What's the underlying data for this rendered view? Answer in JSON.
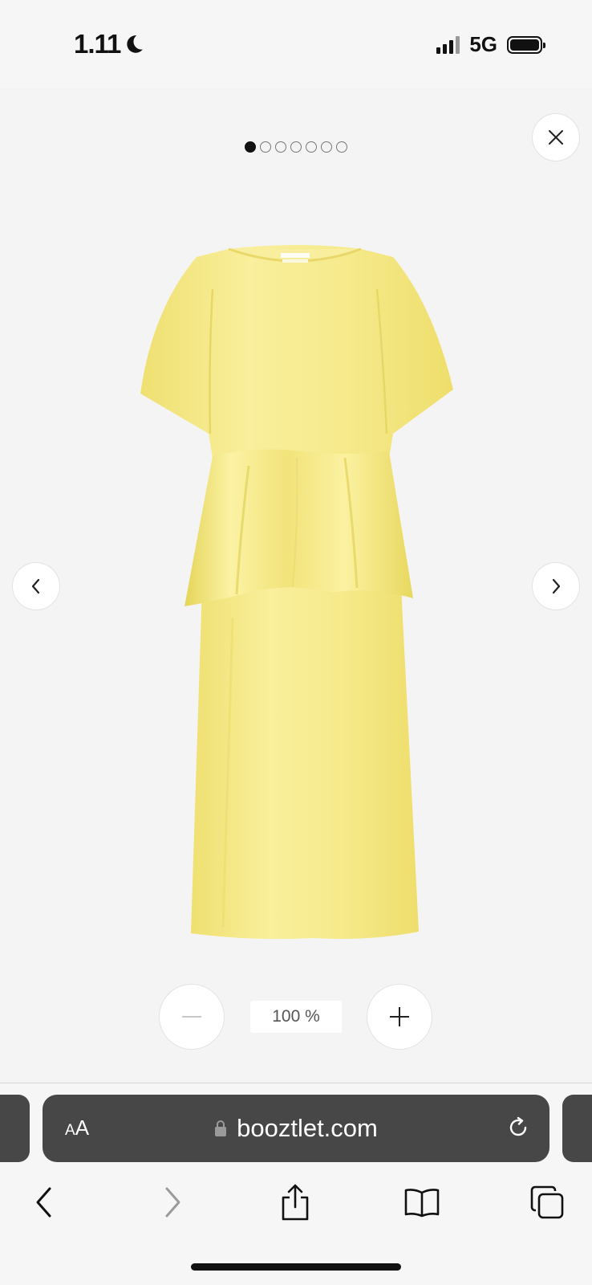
{
  "status_bar": {
    "time": "1.11",
    "network": "5G",
    "icons": [
      "moon-icon",
      "signal-icon",
      "battery-icon"
    ]
  },
  "gallery": {
    "image_count": 7,
    "active_index": 0,
    "image_alt": "Yellow satin midi dress with peplum",
    "icons": [
      "close-icon",
      "chevron-left-icon",
      "chevron-right-icon"
    ]
  },
  "zoom": {
    "level": "100 %",
    "icons": [
      "minus-icon",
      "plus-icon"
    ]
  },
  "browser": {
    "text_size_label_small": "A",
    "text_size_label_large": "A",
    "url": "booztlet.com",
    "icons": [
      "lock-icon",
      "reload-icon",
      "back-icon",
      "forward-icon",
      "share-icon",
      "bookmarks-icon",
      "tabs-icon"
    ]
  },
  "colors": {
    "dress": "#f7e98a",
    "url_bar": "#474747",
    "background": "#f4f4f4"
  }
}
